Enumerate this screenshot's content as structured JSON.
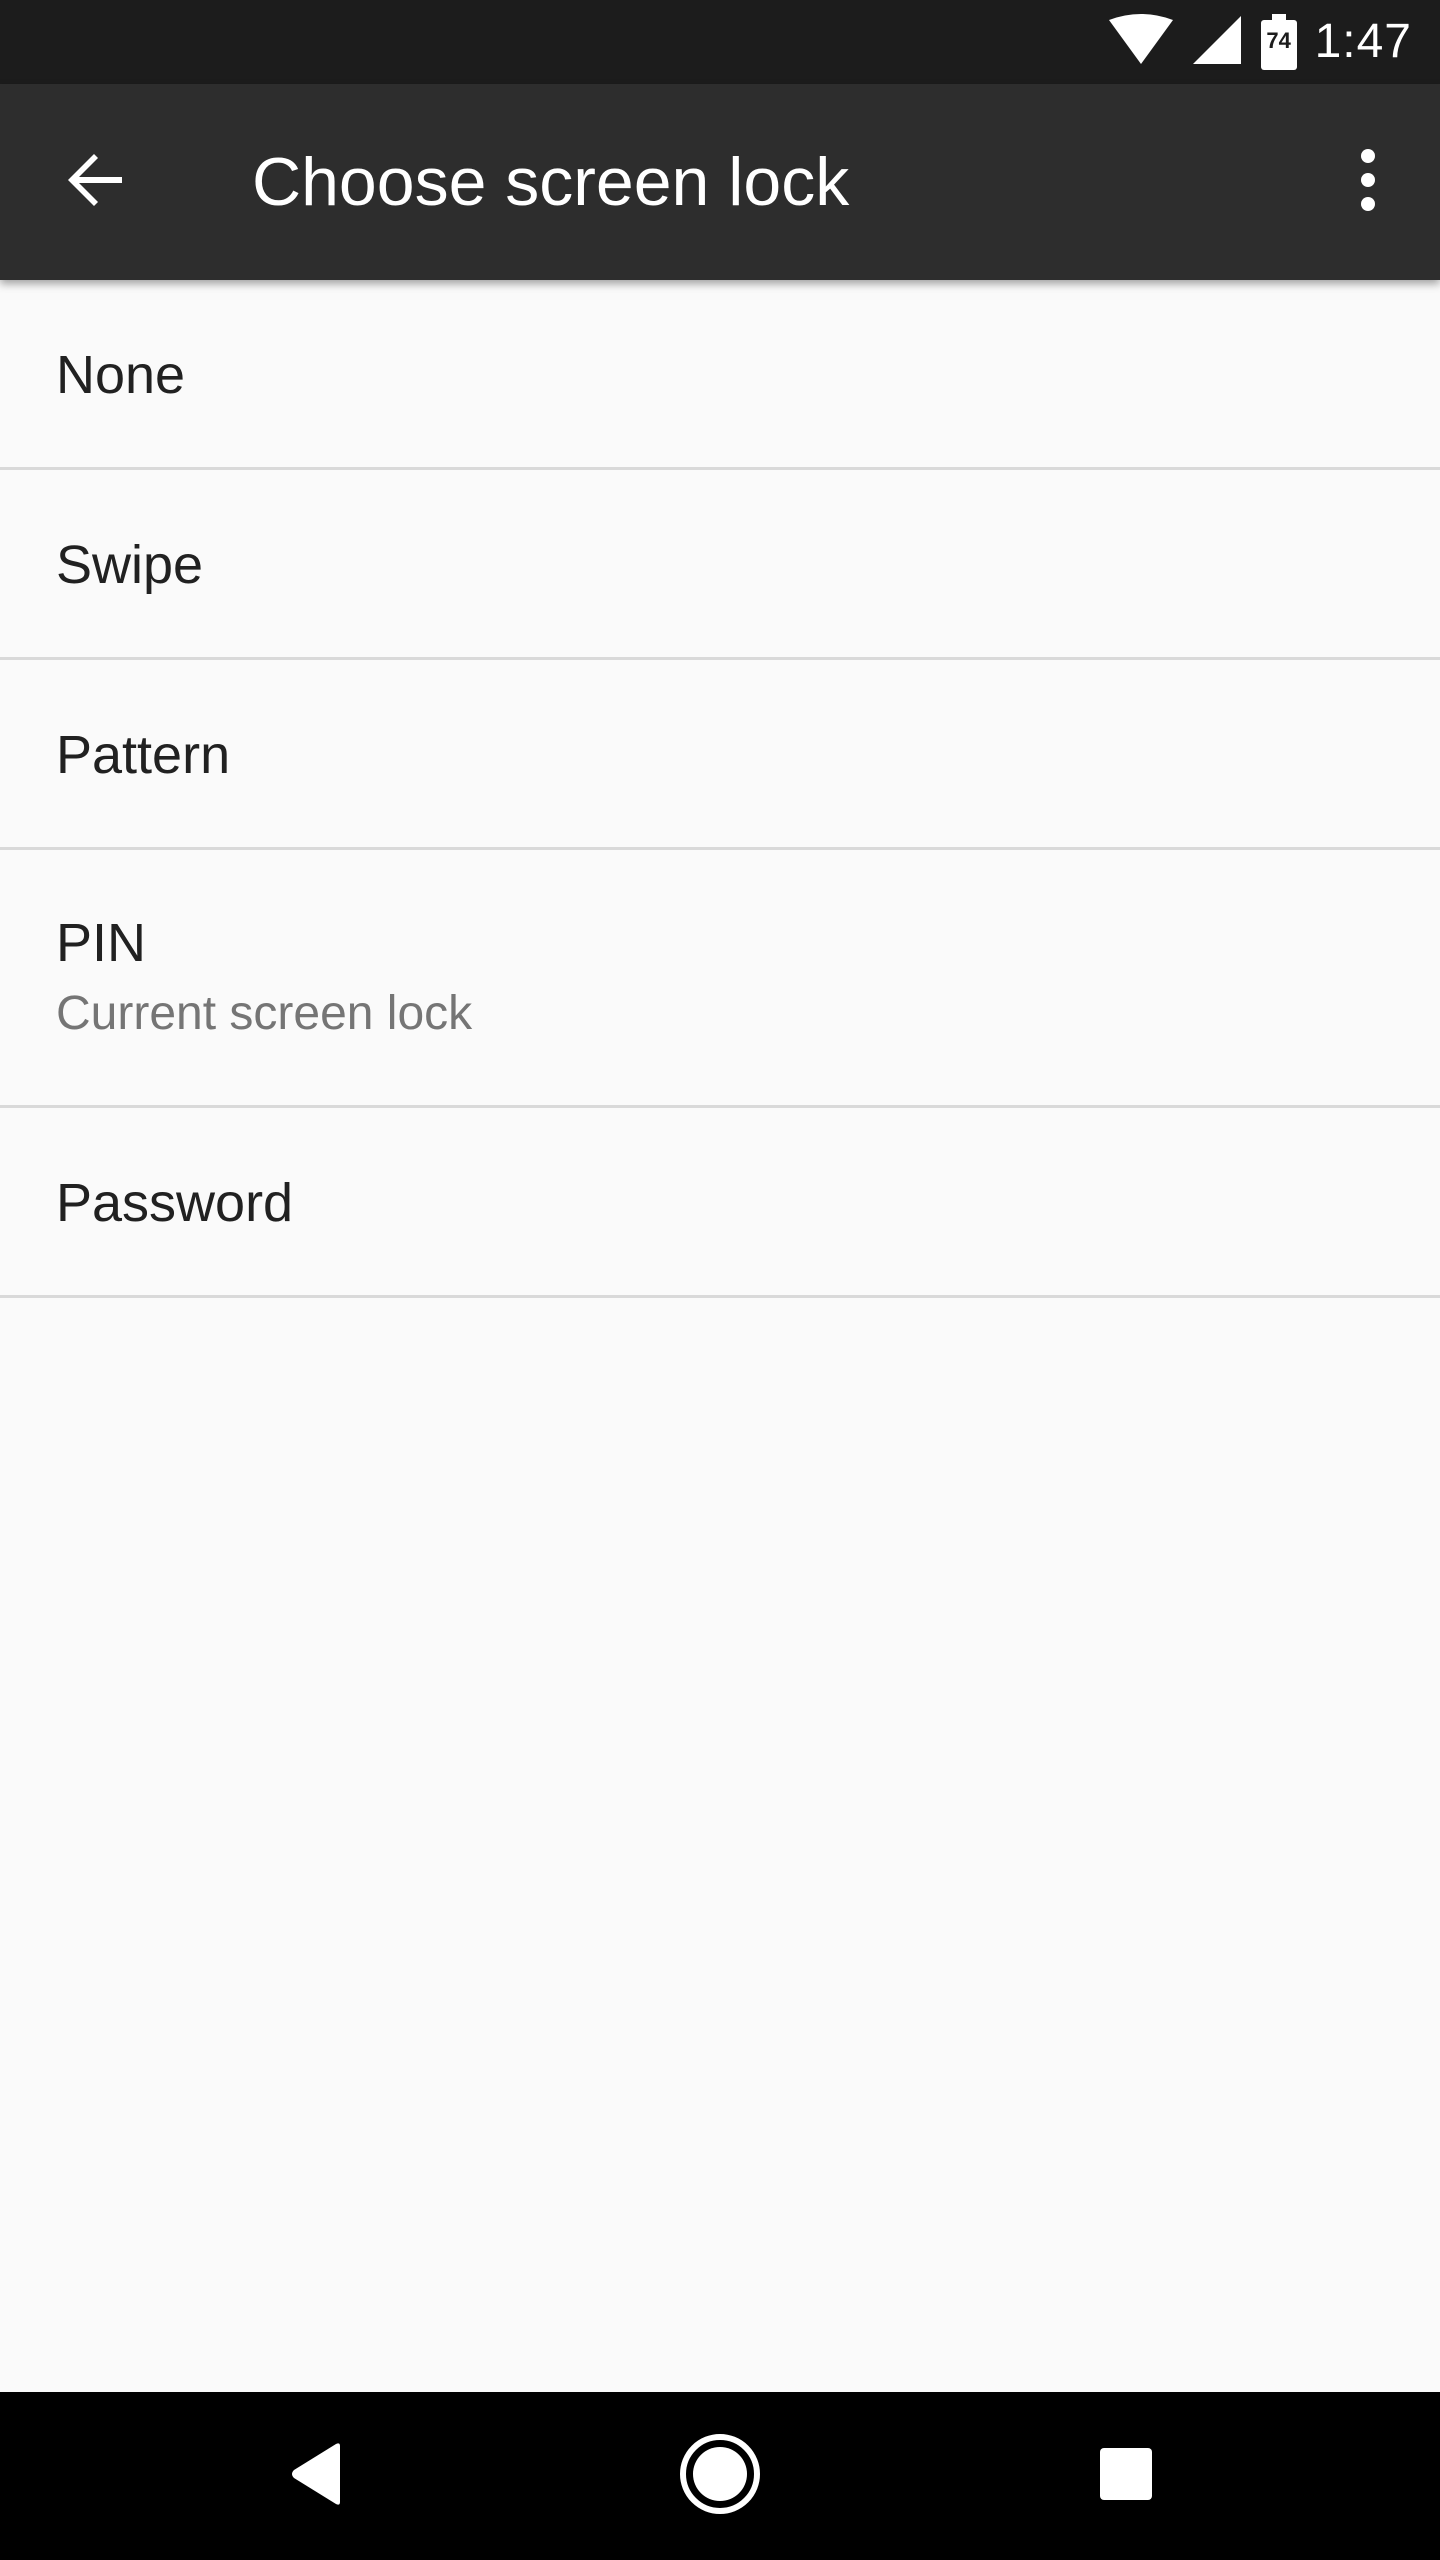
{
  "status_bar": {
    "time": "1:47",
    "battery_level": "74",
    "icons": [
      "wifi-icon",
      "cell-signal-icon",
      "battery-icon"
    ]
  },
  "app_bar": {
    "title": "Choose screen lock",
    "back_icon": "arrow-back-icon",
    "overflow_icon": "more-vert-icon"
  },
  "options": [
    {
      "title": "None",
      "summary": ""
    },
    {
      "title": "Swipe",
      "summary": ""
    },
    {
      "title": "Pattern",
      "summary": ""
    },
    {
      "title": "PIN",
      "summary": "Current screen lock"
    },
    {
      "title": "Password",
      "summary": ""
    }
  ],
  "nav_bar": {
    "icons": [
      "nav-back-icon",
      "nav-home-icon",
      "nav-recents-icon"
    ]
  },
  "colors": {
    "status_bar": "#1c1c1c",
    "app_bar": "#2d2d2d",
    "background": "#fafafa",
    "divider": "#d9d9d9",
    "primary_text": "#212121",
    "secondary_text": "#757575",
    "nav_bar": "#000000"
  }
}
